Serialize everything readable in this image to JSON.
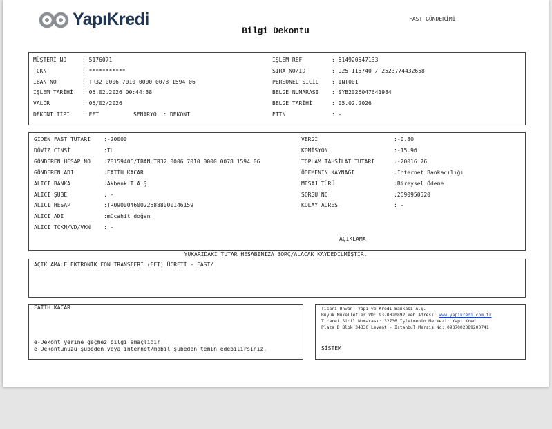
{
  "header": {
    "logo_text": "YapıKredi",
    "title": "Bilgi Dekontu",
    "fast_label": "FAST GÖNDERİMİ"
  },
  "colors": {
    "logo_gray": "#8b8f94",
    "logo_navy": "#1f3550",
    "link": "#1a44b8"
  },
  "icons": {
    "logo": "yapikredi-logo-icon"
  },
  "customer": {
    "left": [
      {
        "label": "MÜŞTERİ NO",
        "value": "5176071"
      },
      {
        "label": "TCKN",
        "value": "***********"
      },
      {
        "label": "IBAN NO",
        "value": "TR32 0006 7010 0000 0078 1594 06"
      },
      {
        "label": "İŞLEM TARİHİ",
        "value": "05.02.2026 00:44:38"
      },
      {
        "label": "VALÖR",
        "value": "05/02/2026"
      },
      {
        "label": "DEKONT TİPİ",
        "value": "EFT",
        "extra_label": "SENARYO",
        "extra_value": "DEKONT"
      }
    ],
    "right": [
      {
        "label": "İŞLEM REF",
        "value": "514920547133"
      },
      {
        "label": "SIRA NO/ID",
        "value": "925-115740 / 2523774432658"
      },
      {
        "label": "PERSONEL SİCİL",
        "value": "INT001"
      },
      {
        "label": "BELGE NUMARASI",
        "value": "SYB2026047641984"
      },
      {
        "label": "BELGE TARİHİ",
        "value": "05.02.2026"
      },
      {
        "label": "ETTN",
        "value": "-"
      }
    ]
  },
  "transfer": {
    "left": [
      {
        "label": "GİDEN FAST TUTARI",
        "value": "-20000"
      },
      {
        "label": "DÖVİZ CİNSİ",
        "value": "TL"
      },
      {
        "label": "GÖNDEREN HESAP NO",
        "value": "78159406/IBAN:TR32 0006 7010 0000 0078 1594 06"
      },
      {
        "label": "GÖNDEREN ADI",
        "value": "FATİH KACAR"
      },
      {
        "label": "ALICI BANKA",
        "value": "Akbank T.A.Ş."
      },
      {
        "label": "ALICI ŞUBE",
        "value": " -"
      },
      {
        "label": "ALICI HESAP",
        "value": "TR090004600225888000146159"
      },
      {
        "label": "ALICI ADI",
        "value": "mücahit doğan"
      },
      {
        "label": "ALICI TCKN/VD/VKN",
        "value": " -"
      }
    ],
    "right": [
      {
        "label": "VERGİ",
        "value": "-0.80"
      },
      {
        "label": "KOMİSYON",
        "value": "-15.96"
      },
      {
        "label": "TOPLAM TAHSİLAT TUTARI",
        "value": "-20016.76"
      },
      {
        "label": "ÖDEMENİN KAYNAĞI",
        "value": "İnternet Bankacılığı"
      },
      {
        "label": "MESAJ TÜRÜ",
        "value": "Bireysel Ödeme"
      },
      {
        "label": "SORGU NO",
        "value": "2590950520"
      },
      {
        "label": "KOLAY ADRES",
        "value": " -"
      }
    ],
    "aciklama_heading": "AÇIKLAMA"
  },
  "notice": "YUKARIDAKİ TUTAR HESABINIZA BORÇ/ALACAK KAYDEDİLMİŞTİR.",
  "description": {
    "label": "AÇIKLAMA",
    "value": "ELEKTRONİK FON TRANSFERİ (EFT) ÜCRETİ - FAST/"
  },
  "footer": {
    "name": "FATİH KACAR",
    "note1": "e-Dekont yerine geçmez bilgi amaçlıdır.",
    "note2": "e-Dekontunuzu şubeden veya internet/mobil şubeden temin edebilirsiniz.",
    "company_line1": "Ticari Unvan: Yapı ve Kredi Bankası A.Ş.",
    "company_line2_prefix": "Büyük Mükellefler VD: 9370020892 Web Adresi: ",
    "company_link": "www.yapikredi.com.tr",
    "company_line3": "Ticaret Sicil Numarası: 32736 İşletmenin Merkezi: Yapı Kredi",
    "company_line4": "Plaza D Blok 34330 Levent - İstanbul Mersis No: 0937002089200741",
    "system": "SİSTEM"
  }
}
